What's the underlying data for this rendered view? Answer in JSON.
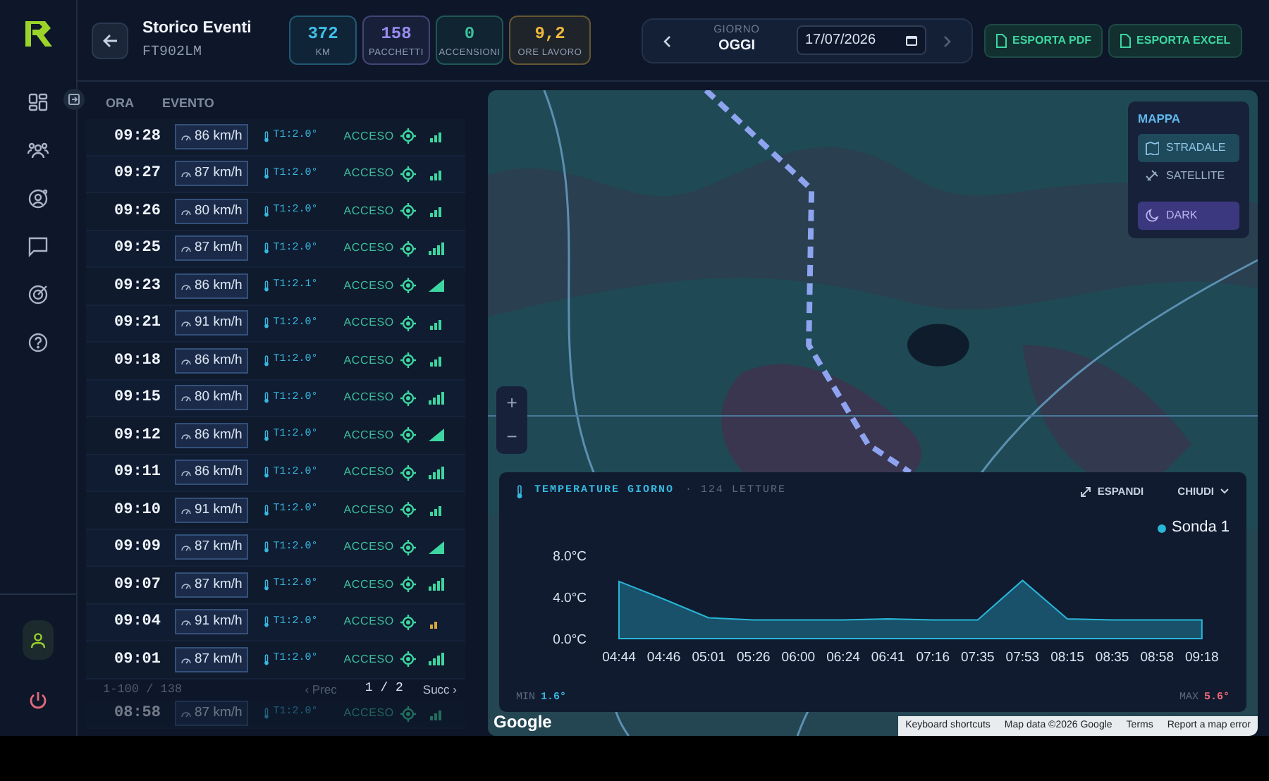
{
  "header": {
    "title": "Storico Eventi",
    "subtitle": "FT902LM"
  },
  "stats": [
    {
      "value": "372",
      "label": "KM",
      "color": "#3fc1e8"
    },
    {
      "value": "158",
      "label": "PACCHETTI",
      "color": "#9a8cf0"
    },
    {
      "value": "0",
      "label": "ACCENSIONI",
      "color": "#3dbf9a"
    },
    {
      "value": "9,2",
      "label": "ORE LAVORO",
      "color": "#f0b93c"
    }
  ],
  "day": {
    "label": "GIORNO",
    "value": "OGGI",
    "date": "17/07/2026",
    "next_disabled": true
  },
  "exports": [
    "ESPORTA PDF",
    "ESPORTA EXCEL"
  ],
  "table": {
    "columns": [
      "ORA",
      "EVENTO"
    ],
    "rows": [
      {
        "time": "09:28",
        "speed": "86 km/h",
        "temp": "T1:2.0°",
        "status": "ACCESO",
        "kind": "medium"
      },
      {
        "time": "09:27",
        "speed": "87 km/h",
        "temp": "T1:2.0°",
        "status": "ACCESO",
        "kind": "medium"
      },
      {
        "time": "09:26",
        "speed": "80 km/h",
        "temp": "T1:2.0°",
        "status": "ACCESO",
        "kind": "medium"
      },
      {
        "time": "09:25",
        "speed": "87 km/h",
        "temp": "T1:2.0°",
        "status": "ACCESO",
        "kind": "high"
      },
      {
        "time": "09:23",
        "speed": "86 km/h",
        "temp": "T1:2.1°",
        "status": "ACCESO",
        "kind": "full"
      },
      {
        "time": "09:21",
        "speed": "91 km/h",
        "temp": "T1:2.0°",
        "status": "ACCESO",
        "kind": "medium"
      },
      {
        "time": "09:18",
        "speed": "86 km/h",
        "temp": "T1:2.0°",
        "status": "ACCESO",
        "kind": "medium"
      },
      {
        "time": "09:15",
        "speed": "80 km/h",
        "temp": "T1:2.0°",
        "status": "ACCESO",
        "kind": "high"
      },
      {
        "time": "09:12",
        "speed": "86 km/h",
        "temp": "T1:2.0°",
        "status": "ACCESO",
        "kind": "full"
      },
      {
        "time": "09:11",
        "speed": "86 km/h",
        "temp": "T1:2.0°",
        "status": "ACCESO",
        "kind": "high"
      },
      {
        "time": "09:10",
        "speed": "91 km/h",
        "temp": "T1:2.0°",
        "status": "ACCESO",
        "kind": "medium"
      },
      {
        "time": "09:09",
        "speed": "87 km/h",
        "temp": "T1:2.0°",
        "status": "ACCESO",
        "kind": "full"
      },
      {
        "time": "09:07",
        "speed": "87 km/h",
        "temp": "T1:2.0°",
        "status": "ACCESO",
        "kind": "high"
      },
      {
        "time": "09:04",
        "speed": "91 km/h",
        "temp": "T1:2.0°",
        "status": "ACCESO",
        "kind": "low"
      },
      {
        "time": "09:01",
        "speed": "87 km/h",
        "temp": "T1:2.0°",
        "status": "ACCESO",
        "kind": "high"
      },
      {
        "time": "08:58",
        "speed": "87 km/h",
        "temp": "T1:2.0°",
        "status": "ACCESO",
        "kind": "medium"
      }
    ],
    "pagination": {
      "range": "1-100 / 138",
      "prev": "‹ Prec",
      "prev_disabled": true,
      "page": "1 / 2",
      "next": "Succ ›"
    }
  },
  "map": {
    "kind": "picture",
    "panel_title": "MAPPA",
    "modes": [
      {
        "label": "STRADALE",
        "kind": "option",
        "selected": true
      },
      {
        "label": "SATELLITE",
        "kind": "option",
        "selected": false
      },
      {
        "label": "DARK",
        "kind": "toggle",
        "on": true
      }
    ],
    "zoom": [
      "+",
      "−"
    ],
    "logo": "Google",
    "attribution": [
      "Keyboard shortcuts",
      "Map data ©2026 Google",
      "Terms",
      "Report a map error"
    ]
  },
  "temperature": {
    "title": "TEMPERATURE GIORNO",
    "count": "· 124 LETTURE",
    "expand": "ESPANDI",
    "close": "CHIUDI",
    "min_label": "MIN",
    "min": "1.6°",
    "max_label": "MAX",
    "max": "5.6°",
    "chart_data": {
      "type": "area",
      "categories": [
        "04:44",
        "04:46",
        "05:01",
        "05:26",
        "06:00",
        "06:24",
        "06:41",
        "07:16",
        "07:35",
        "07:53",
        "08:15",
        "08:35",
        "08:58",
        "09:18"
      ],
      "series": [
        {
          "name": "Sonda 1",
          "color": "#29b6d8",
          "values": [
            5.5,
            3.8,
            2.0,
            1.8,
            1.8,
            1.8,
            1.9,
            1.8,
            1.8,
            5.6,
            1.9,
            1.8,
            1.8,
            1.8
          ]
        }
      ],
      "ylim": [
        0,
        8
      ],
      "yticks": [
        {
          "value": 0,
          "label": "0.0°C"
        },
        {
          "value": 4,
          "label": "4.0°C"
        },
        {
          "value": 8,
          "label": "8.0°C"
        }
      ]
    }
  }
}
